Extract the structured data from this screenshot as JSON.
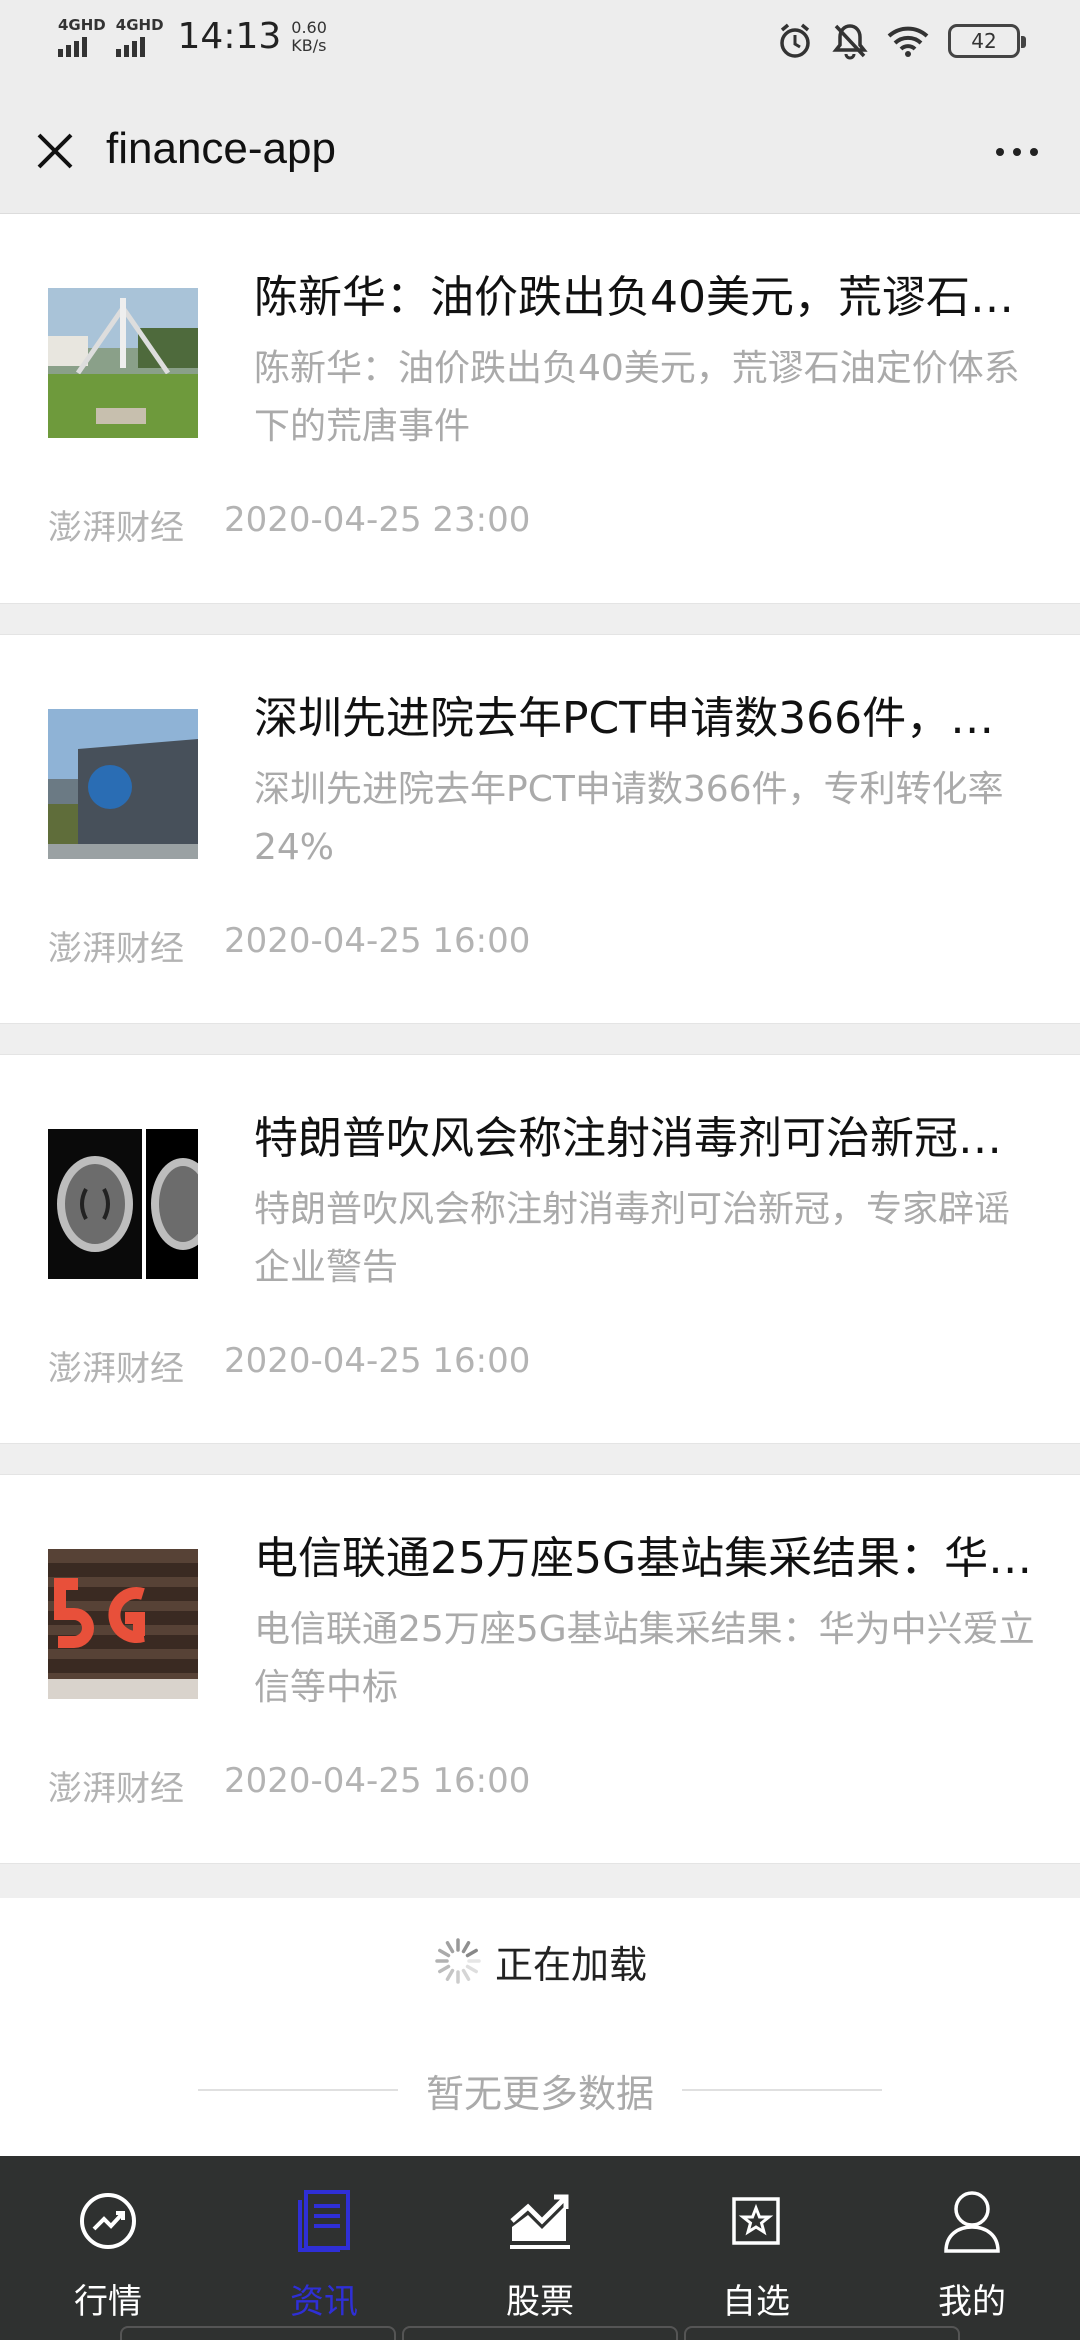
{
  "status_bar": {
    "signal1_label": "4GHD",
    "signal2_label": "4GHD",
    "time": "14:13",
    "speed_value": "0.60",
    "speed_unit": "KB/s",
    "battery": "42"
  },
  "header": {
    "title": "finance-app",
    "close_icon": "close-icon",
    "more_icon": "more-dots-icon"
  },
  "news": [
    {
      "title": "陈新华：油价跌出负40美元，荒谬石油定价体系下的荒唐事件",
      "summary": "陈新华：油价跌出负40美元，荒谬石油定价体系下的荒唐事件",
      "source": "澎湃财经",
      "time": "2020-04-25 23:00"
    },
    {
      "title": "深圳先进院去年PCT申请数366件，专利转化率24%",
      "summary": "深圳先进院去年PCT申请数366件，专利转化率24%",
      "source": "澎湃财经",
      "time": "2020-04-25 16:00"
    },
    {
      "title": "特朗普吹风会称注射消毒剂可治新冠，专家辟谣企业警告",
      "summary": "特朗普吹风会称注射消毒剂可治新冠，专家辟谣企业警告",
      "source": "澎湃财经",
      "time": "2020-04-25 16:00"
    },
    {
      "title": "电信联通25万座5G基站集采结果：华为中兴爱立信等中标",
      "summary": "电信联通25万座5G基站集采结果：华为中兴爱立信等中标",
      "source": "澎湃财经",
      "time": "2020-04-25 16:00"
    }
  ],
  "loading_text": "正在加载",
  "end_text": "暂无更多数据",
  "tabs": [
    {
      "label": "行情",
      "icon": "trend-circle-icon",
      "active": false
    },
    {
      "label": "资讯",
      "icon": "news-document-icon",
      "active": true
    },
    {
      "label": "股票",
      "icon": "stock-chart-icon",
      "active": false
    },
    {
      "label": "自选",
      "icon": "star-box-icon",
      "active": false
    },
    {
      "label": "我的",
      "icon": "user-icon",
      "active": false
    }
  ],
  "colors": {
    "active_tab": "#2f2fd6",
    "tab_bar_bg": "#2f3130",
    "summary_text": "#aaaaaa"
  }
}
